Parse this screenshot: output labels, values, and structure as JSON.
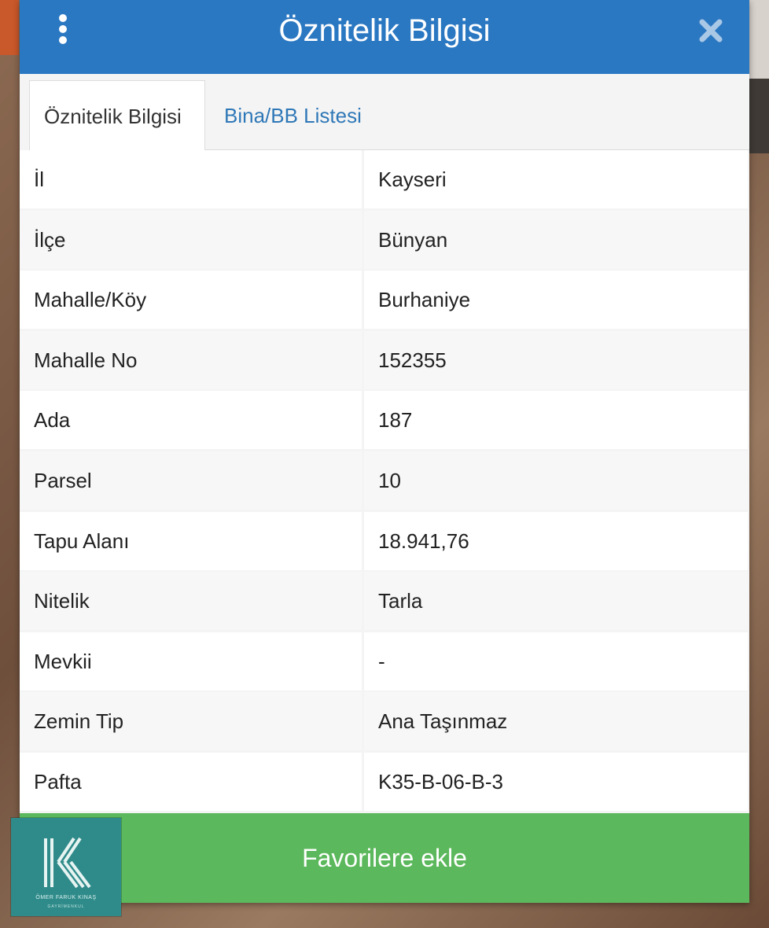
{
  "dialog": {
    "title": "Öznitelik Bilgisi",
    "menu_icon": "more-vertical-icon",
    "close_icon": "close-icon"
  },
  "tabs": [
    {
      "label": "Öznitelik Bilgisi",
      "active": true
    },
    {
      "label": "Bina/BB Listesi",
      "active": false
    }
  ],
  "attributes": [
    {
      "key": "İl",
      "value": "Kayseri"
    },
    {
      "key": "İlçe",
      "value": "Bünyan"
    },
    {
      "key": "Mahalle/Köy",
      "value": "Burhaniye"
    },
    {
      "key": "Mahalle No",
      "value": "152355"
    },
    {
      "key": "Ada",
      "value": "187"
    },
    {
      "key": "Parsel",
      "value": "10"
    },
    {
      "key": "Tapu Alanı",
      "value": "18.941,76"
    },
    {
      "key": "Nitelik",
      "value": "Tarla"
    },
    {
      "key": "Mevkii",
      "value": "-"
    },
    {
      "key": "Zemin Tip",
      "value": "Ana Taşınmaz"
    },
    {
      "key": "Pafta",
      "value": "K35-B-06-B-3"
    }
  ],
  "favorite_button": {
    "label": "Favorilere ekle"
  },
  "logo": {
    "name": "ÖMER FARUK KINAŞ",
    "subtitle": "GAYRİMENKUL"
  },
  "colors": {
    "header": "#2b78c2",
    "favorite": "#5cb85c",
    "tab_link": "#2f78b7"
  }
}
